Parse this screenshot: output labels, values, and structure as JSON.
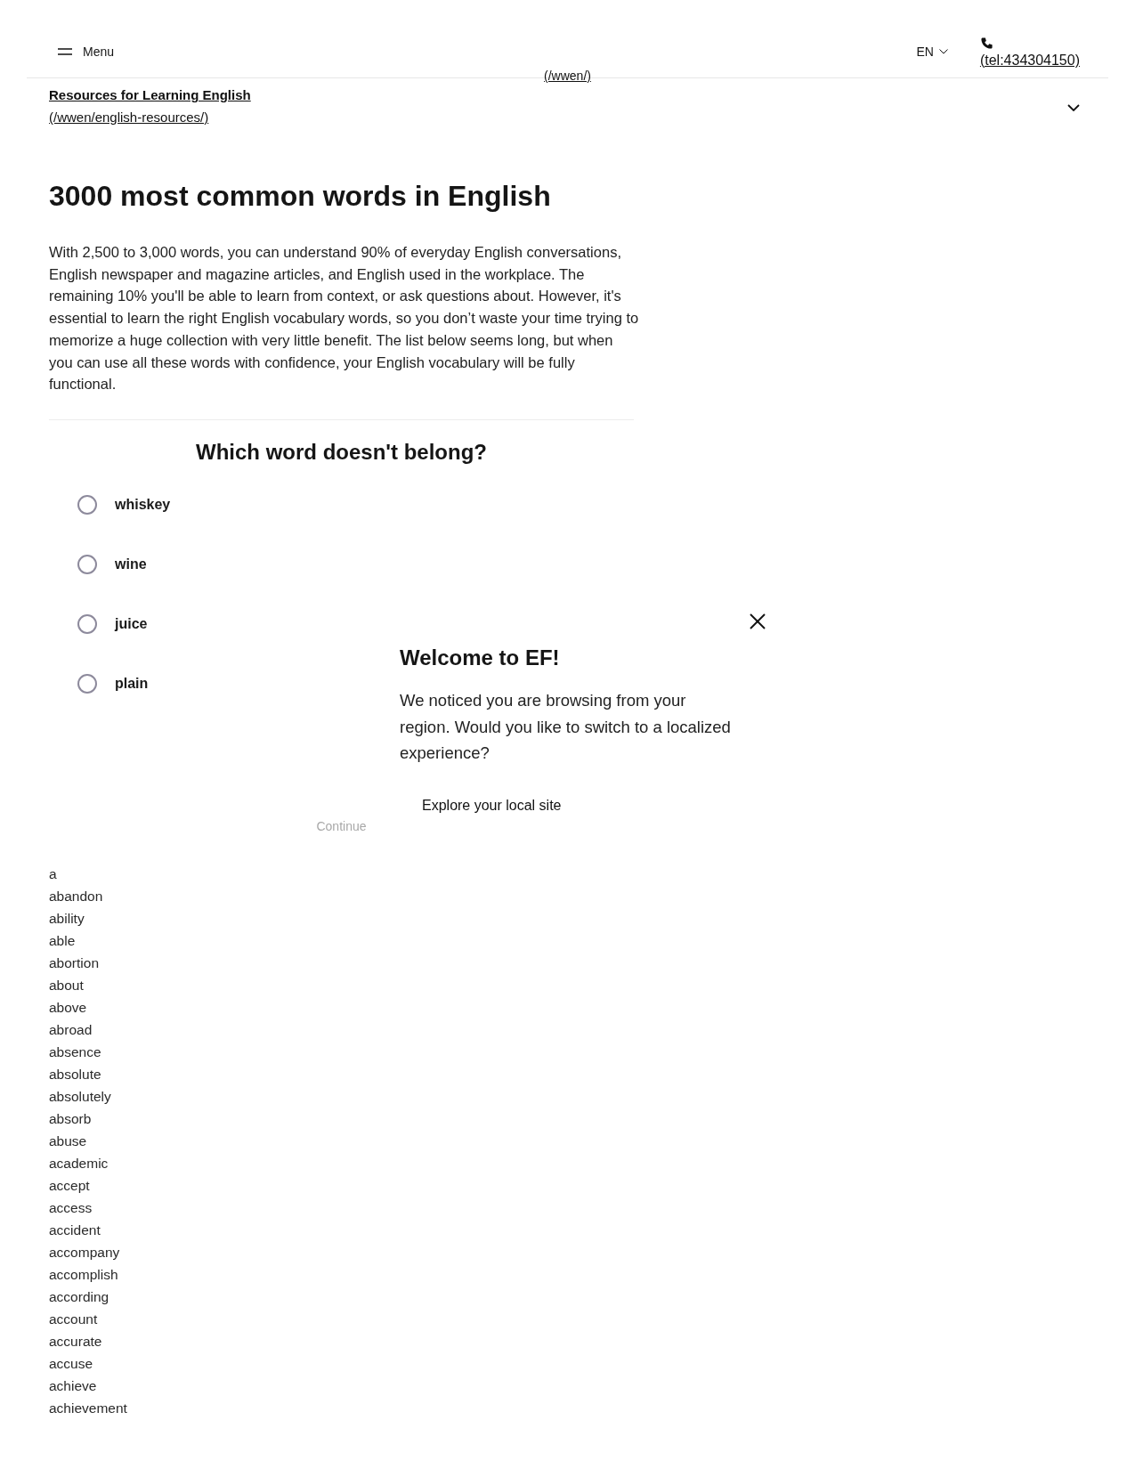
{
  "header": {
    "menu_label": "Menu",
    "home_link": "(/wwen/)",
    "language": "EN",
    "phone_link": "(tel:434304150)"
  },
  "breadcrumb": {
    "title": "Resources for Learning English",
    "link": "(/wwen/english-resources/)",
    "expanded": false
  },
  "article": {
    "title": "3000 most common words in English",
    "intro": "With 2,500 to 3,000 words, you can understand 90% of everyday English conversations, English newspaper and magazine articles, and English used in the workplace. The remaining 10% you'll be able to learn from context, or ask questions about. However, it's essential to learn the right English vocabulary words, so you don’t waste your time trying to memorize a huge collection with very little benefit. The list below seems long, but when you can use all these words with confidence, your English vocabulary will be fully functional."
  },
  "quiz": {
    "question": "Which word doesn't belong?",
    "options": [
      {
        "label": "whiskey",
        "selected": false
      },
      {
        "label": "wine",
        "selected": false
      },
      {
        "label": "juice",
        "selected": false
      },
      {
        "label": "plain",
        "selected": false
      }
    ],
    "continue": {
      "label": "Continue",
      "disabled": true
    }
  },
  "popup": {
    "title": "Welcome to EF!",
    "message": "We noticed you are browsing from your region. Would you like to switch to a localized experience?",
    "action": "Explore your local site"
  },
  "words": [
    "a",
    "abandon",
    "ability",
    "able",
    "abortion",
    "about",
    "above",
    "abroad",
    "absence",
    "absolute",
    "absolutely",
    "absorb",
    "abuse",
    "academic",
    "accept",
    "access",
    "accident",
    "accompany",
    "accomplish",
    "according",
    "account",
    "accurate",
    "accuse",
    "achieve",
    "achievement"
  ]
}
